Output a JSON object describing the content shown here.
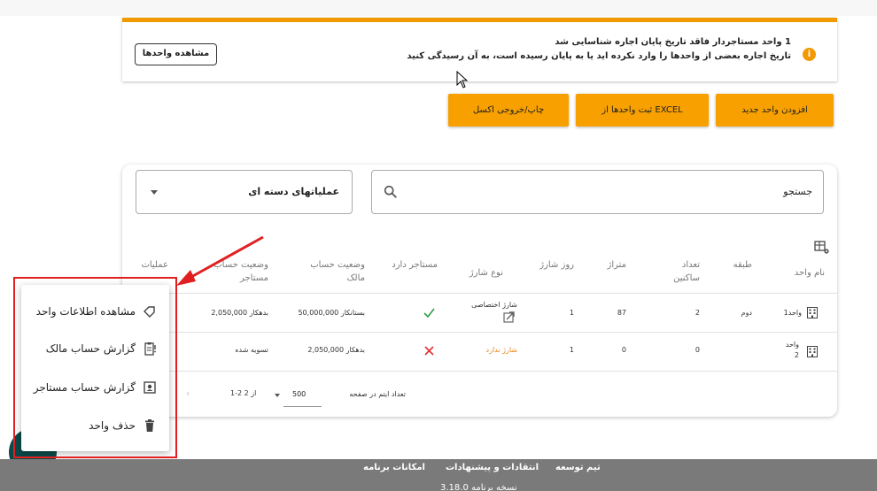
{
  "alert": {
    "icon": "info-icon",
    "title": "1 واحد مستاجردار فاقد تاریخ پایان اجاره شناسایی شد",
    "text": "تاریخ اجاره بعضی از واحدها را وارد نکرده اید یا به پایان رسیده است، به آن رسیدگی کنید",
    "button": "مشاهده واحدها",
    "color": "#f29900"
  },
  "actions": {
    "add_unit": "افزودن واحد جدید",
    "import_excel": "ثبت واحدها از EXCEL",
    "print_export": "چاپ/خروجی اکسل",
    "color": "#f7a000"
  },
  "search": {
    "label": "جستجو",
    "icon": "search-icon"
  },
  "bulk": {
    "label": "عملیاتهای دسته ای",
    "icon": "chevron-down-icon"
  },
  "table": {
    "headers": {
      "unit_name": "نام واحد",
      "floor": "طبقه",
      "residents": "تعداد ساکنین",
      "area": "متراژ",
      "charge_day": "روز شارژ",
      "charge_type": "نوع شارژ",
      "has_tenant": "مستاجر دارد",
      "owner_status": "وضعیت حساب مالک",
      "tenant_status": "وضعیت حساب مستاجر",
      "operations": "عملیات"
    },
    "rows": [
      {
        "unit_name": "واحد1",
        "floor": "دوم",
        "residents": "2",
        "area": "87",
        "charge_day": "1",
        "charge_type": "شارژ اختصاصی",
        "has_tenant": "check",
        "owner_status": "50,000,000 بستانکار",
        "tenant_status": "2,050,000 بدهکار"
      },
      {
        "unit_name": "واحد 2",
        "floor": "",
        "residents": "0",
        "area": "0",
        "charge_day": "1",
        "charge_type": "شارژ ندارد",
        "has_tenant": "cross",
        "owner_status": "2,050,000 بدهکار",
        "tenant_status": "تسویه شده"
      }
    ],
    "colors": {
      "check": "#2e9e44",
      "cross": "#e03030",
      "no_charge": "#e8821a"
    }
  },
  "pagination": {
    "rows_per_page_label": "تعداد ایتم در صفحه",
    "rows_per_page": "500",
    "range": "1-2 از 2"
  },
  "context_menu": {
    "items": [
      {
        "label": "مشاهده اطلاعات واحد",
        "icon": "tag-edit-icon"
      },
      {
        "label": "گزارش حساب مالک",
        "icon": "clipboard-report-icon"
      },
      {
        "label": "گزارش حساب مستاجر",
        "icon": "account-box-icon"
      },
      {
        "label": "حذف واحد",
        "icon": "trash-icon"
      }
    ],
    "highlight_color": "#e02020"
  },
  "footer": {
    "team": "تیم توسعه",
    "feedback": "انتقادات و پیشنهادات",
    "features": "امکانات برنامه",
    "version": "نسخه برنامه 3.18.0"
  }
}
